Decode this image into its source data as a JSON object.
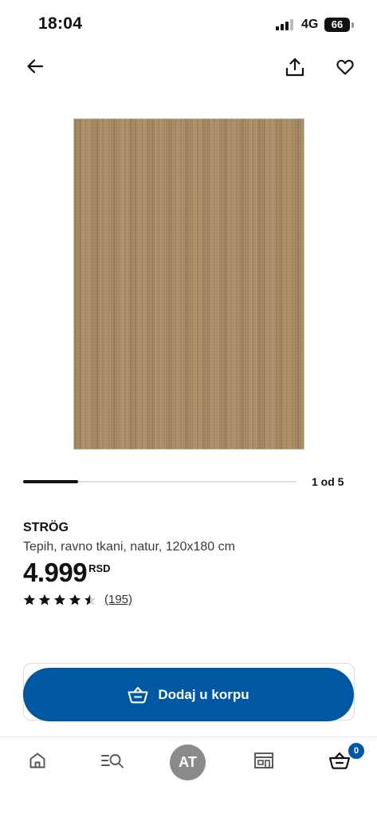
{
  "status_bar": {
    "time": "18:04",
    "network": "4G",
    "battery": "66",
    "signal_bars_active": 3,
    "signal_bars_total": 4
  },
  "top_bar": {
    "back_icon": "arrow-left-icon",
    "share_icon": "share-icon",
    "favorite_icon": "heart-icon"
  },
  "gallery": {
    "pager": "1 od 5",
    "current": 1,
    "total": 5
  },
  "product": {
    "name": "STRÖG",
    "description": "Tepih, ravno tkani, natur, 120x180 cm",
    "price": "4.999",
    "currency": "RSD",
    "rating": 4.5,
    "rating_max": 5,
    "reviews": "(195)"
  },
  "cart": {
    "add_label": "Dodaj u korpu",
    "button_color": "#0058a3",
    "cart_badge": "0"
  },
  "bottom_nav": {
    "items": [
      "home-icon",
      "search-list-icon",
      "avatar",
      "store-icon",
      "cart-icon"
    ],
    "avatar_initials": "AT"
  }
}
